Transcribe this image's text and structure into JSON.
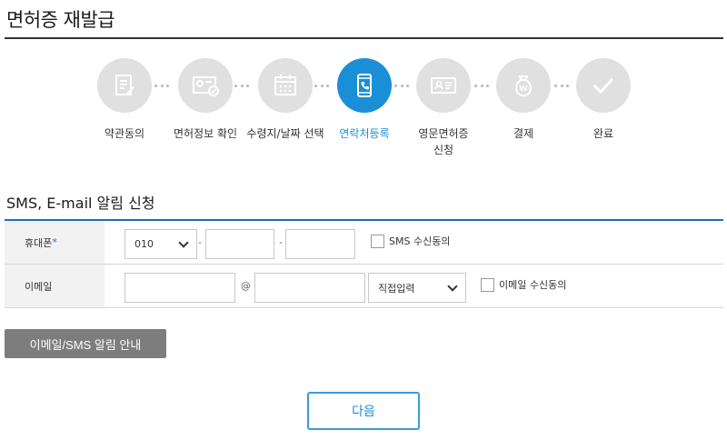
{
  "page": {
    "title": "면허증 재발급"
  },
  "steps": [
    {
      "label": "약관동의",
      "icon": "document-icon",
      "active": false
    },
    {
      "label": "면허정보 확인",
      "icon": "id-card-check-icon",
      "active": false
    },
    {
      "label": "수령지/날짜 선택",
      "icon": "calendar-icon",
      "active": false
    },
    {
      "label": "연락처등록",
      "icon": "phone-icon",
      "active": true
    },
    {
      "label": "영문면허증\n신청",
      "icon": "license-card-icon",
      "active": false
    },
    {
      "label": "결제",
      "icon": "money-bag-icon",
      "active": false
    },
    {
      "label": "완료",
      "icon": "checkmark-icon",
      "active": false
    }
  ],
  "section": {
    "title": "SMS, E-mail 알림 신청"
  },
  "phone": {
    "label": "휴대폰",
    "required_mark": "*",
    "prefix": "010",
    "dash": "-",
    "sms_consent": "SMS 수신동의"
  },
  "email": {
    "label": "이메일",
    "at": "@",
    "domain_select": "직접입력",
    "email_consent": "이메일 수신동의"
  },
  "buttons": {
    "notice": "이메일/SMS 알림 안내",
    "next": "다음"
  },
  "colors": {
    "accent": "#1a8fd8",
    "inactive_step": "#e0e0e0",
    "form_border": "#1a6fc0"
  }
}
